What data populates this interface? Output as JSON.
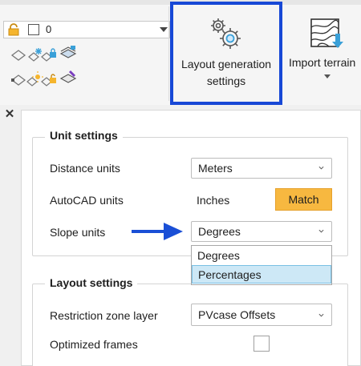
{
  "ribbon": {
    "layer_value": "0",
    "layout_generation": {
      "label_line1": "Layout generation",
      "label_line2": "settings"
    },
    "import_terrain": {
      "label": "Import terrain"
    },
    "highlight_color": "#1748d6"
  },
  "unit_settings": {
    "title": "Unit settings",
    "distance_units": {
      "label": "Distance units",
      "value": "Meters"
    },
    "autocad_units": {
      "label": "AutoCAD units",
      "value": "Inches",
      "button": "Match"
    },
    "slope_units": {
      "label": "Slope units",
      "value": "Degrees",
      "options": [
        "Degrees",
        "Percentages"
      ],
      "highlighted_option": "Percentages"
    }
  },
  "layout_settings": {
    "title": "Layout settings",
    "restriction_zone_layer": {
      "label": "Restriction zone layer",
      "value": "PVcase Offsets"
    },
    "optimized_frames": {
      "label": "Optimized frames",
      "checked": false
    }
  },
  "colors": {
    "accent_button": "#f7b840",
    "arrow": "#1a4fd6",
    "selection": "#cde8f6"
  }
}
